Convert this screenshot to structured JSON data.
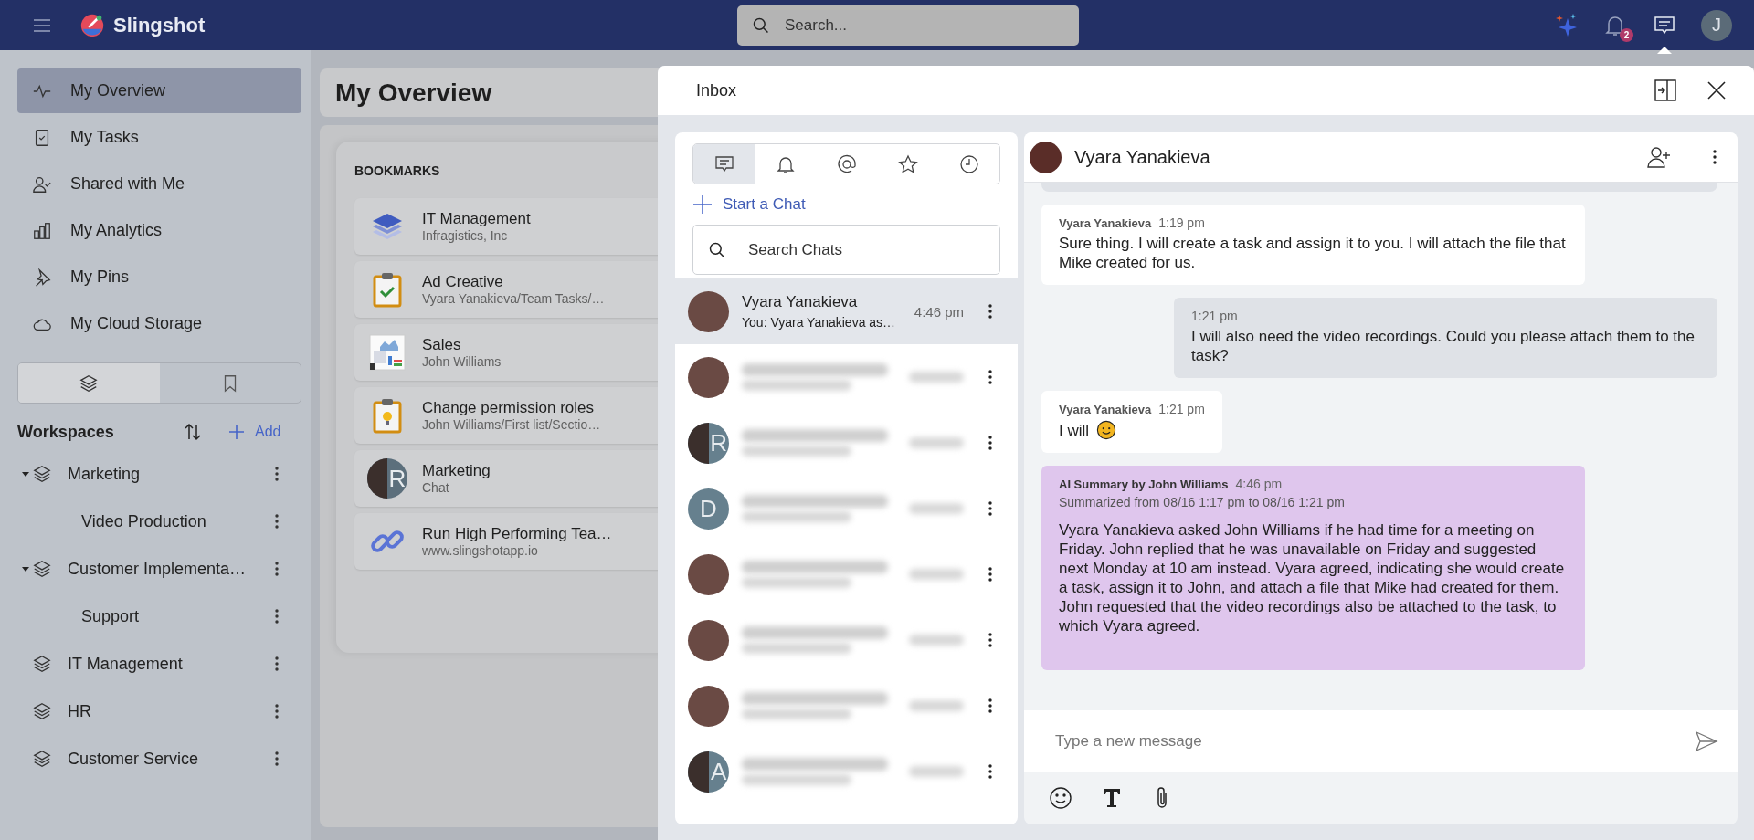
{
  "app": {
    "name": "Slingshot"
  },
  "top_bar": {
    "search": {
      "placeholder": "Search..."
    },
    "notification_count": "2",
    "avatar_letter": "J"
  },
  "sidebar": {
    "nav": [
      {
        "label": "My Overview",
        "kind": "pulse",
        "selected": true
      },
      {
        "label": "My Tasks",
        "kind": "tasks",
        "selected": false
      },
      {
        "label": "Shared with Me",
        "kind": "shared",
        "selected": false
      },
      {
        "label": "My Analytics",
        "kind": "analytics",
        "selected": false
      },
      {
        "label": "My Pins",
        "kind": "pin",
        "selected": false
      },
      {
        "label": "My Cloud Storage",
        "kind": "cloud",
        "selected": false
      }
    ],
    "view_tabs": [
      {
        "kind": "layers",
        "selected": true
      },
      {
        "kind": "bookmark",
        "selected": false
      }
    ],
    "workspaces": {
      "title": "Workspaces",
      "add_label": "Add",
      "items": [
        {
          "label": "Marketing",
          "expanded": true,
          "children": [
            {
              "label": "Video Production"
            }
          ]
        },
        {
          "label": "Customer Implementa…",
          "expanded": true,
          "children": [
            {
              "label": "Support"
            }
          ]
        },
        {
          "label": "IT Management",
          "expanded": false
        },
        {
          "label": "HR",
          "expanded": false
        },
        {
          "label": "Customer Service",
          "expanded": false
        }
      ]
    }
  },
  "page": {
    "title": "My Overview",
    "bookmarks": {
      "title": "BOOKMARKS",
      "items": [
        {
          "title": "IT Management",
          "subtitle": "Infragistics, Inc",
          "kind": "workspace"
        },
        {
          "title": "Ad Creative",
          "subtitle": "Vyara Yanakieva/Team Tasks/…",
          "kind": "task"
        },
        {
          "title": "Sales",
          "subtitle": "John Williams",
          "kind": "dashboard"
        },
        {
          "title": "Change permission roles",
          "subtitle": "John Williams/First list/Sectio…",
          "kind": "idea"
        },
        {
          "title": "Marketing",
          "subtitle": "Chat",
          "kind": "chat",
          "avatar_letter": "R"
        },
        {
          "title": "Run High Performing Tea…",
          "subtitle": "www.slingshotapp.io",
          "kind": "link"
        }
      ]
    }
  },
  "inbox": {
    "title": "Inbox",
    "tabs": [
      {
        "kind": "chat",
        "selected": true
      },
      {
        "kind": "bell",
        "selected": false
      },
      {
        "kind": "mention",
        "selected": false
      },
      {
        "kind": "star",
        "selected": false
      },
      {
        "kind": "clock",
        "selected": false
      }
    ],
    "start_chat": "Start a Chat",
    "search": {
      "placeholder": "Search Chats"
    },
    "chats": [
      {
        "name": "Vyara Yanakieva",
        "preview": "You: Vyara Yanakieva as…",
        "time": "4:46 pm",
        "selected": true
      },
      {
        "selected": false
      },
      {
        "selected": false,
        "avatar_letter": "R"
      },
      {
        "selected": false,
        "avatar_letter": "D"
      },
      {
        "selected": false
      },
      {
        "selected": false
      },
      {
        "selected": false
      },
      {
        "selected": false,
        "avatar_letter": "A"
      }
    ]
  },
  "conversation": {
    "contact": "Vyara Yanakieva",
    "messages": [
      {
        "kind": "incoming",
        "author": "Vyara Yanakieva",
        "time": "1:19 pm",
        "text": "Sure thing. I will create a task and assign it to you. I will attach the file that Mike created for us."
      },
      {
        "kind": "outgoing",
        "time": "1:21 pm",
        "text": "I will also need the video recordings. Could you please attach them to the task?"
      },
      {
        "kind": "incoming",
        "author": "Vyara Yanakieva",
        "time": "1:21 pm",
        "text": "I will",
        "emoji": true
      },
      {
        "kind": "summary",
        "author": "AI Summary by John Williams",
        "time": "4:46 pm",
        "range": "Summarized from 08/16 1:17 pm to 08/16 1:21 pm",
        "text": "Vyara Yanakieva asked John Williams if he had time for a meeting on Friday. John replied that he was unavailable on Friday and suggested next Monday at 10 am instead. Vyara agreed, indicating she would create a task, assign it to John, and attach a file that Mike had created for them. John requested that the video recordings also be attached to the task, to which Vyara agreed."
      }
    ],
    "composer": {
      "placeholder": "Type a new message"
    }
  }
}
